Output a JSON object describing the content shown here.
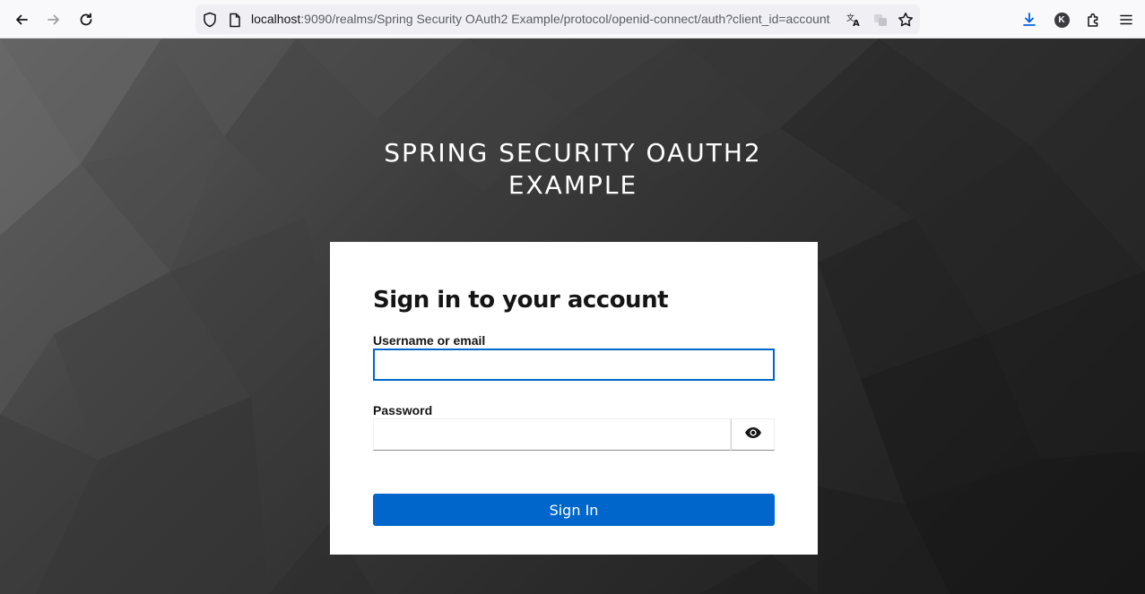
{
  "browser": {
    "url_host": "localhost",
    "url_rest": ":9090/realms/Spring Security OAuth2 Example/protocol/openid-connect/auth?client_id=account",
    "profile_initial": "K",
    "icons": {
      "back": "arrow-left-icon",
      "forward": "arrow-right-icon",
      "reload": "reload-icon",
      "tracking": "shield-icon",
      "page_info": "page-icon",
      "translate": "translate-icon",
      "reader": "reader-view-icon",
      "bookmark": "star-icon",
      "downloads": "download-icon",
      "extensions": "puzzle-icon",
      "menu": "hamburger-menu-icon"
    },
    "colors": {
      "toolbar": "#f9f9fb",
      "urlbar": "#f0f0f4",
      "download_accent": "#0061e0"
    }
  },
  "login": {
    "realm_title_line1": "SPRING SECURITY OAUTH2",
    "realm_title_line2": "EXAMPLE",
    "heading": "Sign in to your account",
    "username_label": "Username or email",
    "username_value": "",
    "password_label": "Password",
    "password_value": "",
    "show_password_icon": "eye-icon",
    "submit_label": "Sign In",
    "colors": {
      "primary": "#0066cc",
      "card": "#ffffff",
      "text": "#151515"
    }
  }
}
